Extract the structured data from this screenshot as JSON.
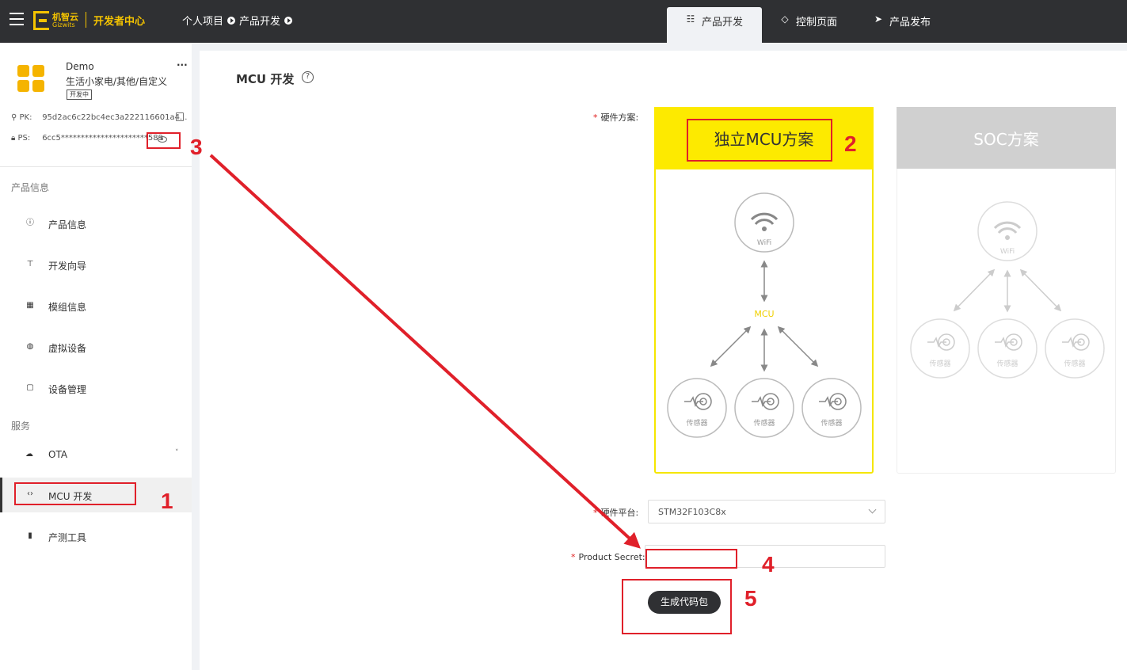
{
  "topbar": {
    "logo_text": "机智云",
    "logo_sub": "Gizwits",
    "dev_center": "开发者中心",
    "breadcrumb": [
      "个人项目",
      "产品开发"
    ],
    "tabs": [
      {
        "label": "产品开发",
        "icon": "sliders-icon",
        "active": true
      },
      {
        "label": "控制页面",
        "icon": "diamond-icon",
        "active": false
      },
      {
        "label": "产品发布",
        "icon": "send-icon",
        "active": false
      }
    ]
  },
  "sidebar": {
    "app_name": "Demo",
    "app_category": "生活小家电/其他/自定义",
    "app_status": "开发中",
    "more": "...",
    "pk_label": "PK:",
    "pk_value": "95d2ac6c22bc4ec3a222116601a4...",
    "ps_label": "PS:",
    "ps_value": "6cc5**********************589",
    "section_product": "产品信息",
    "section_service": "服务",
    "items": [
      {
        "label": "产品信息",
        "icon": "info-icon"
      },
      {
        "label": "开发向导",
        "icon": "signpost-icon"
      },
      {
        "label": "模组信息",
        "icon": "grid-icon"
      },
      {
        "label": "虚拟设备",
        "icon": "globe-icon"
      },
      {
        "label": "设备管理",
        "icon": "clipboard-icon"
      },
      {
        "label": "OTA",
        "icon": "cloud-icon"
      },
      {
        "label": "MCU 开发",
        "icon": "code-icon",
        "active": true
      },
      {
        "label": "产测工具",
        "icon": "tool-icon"
      }
    ]
  },
  "main": {
    "title": "MCU 开发",
    "hardware_label": "硬件方案:",
    "mcu_card_title": "独立MCU方案",
    "soc_card_title": "SOC方案",
    "wifi_label": "WiFi",
    "mcu_label": "MCU",
    "sensor_label": "传感器",
    "platform_label": "硬件平台:",
    "platform_value": "STM32F103C8x",
    "secret_label": "Product Secret:",
    "secret_value": "",
    "generate_button": "生成代码包"
  },
  "annotations": [
    "1",
    "2",
    "3",
    "4",
    "5"
  ],
  "colors": {
    "accent": "#fdea00",
    "topbar": "#2f3033",
    "annotation": "#e0202a"
  }
}
